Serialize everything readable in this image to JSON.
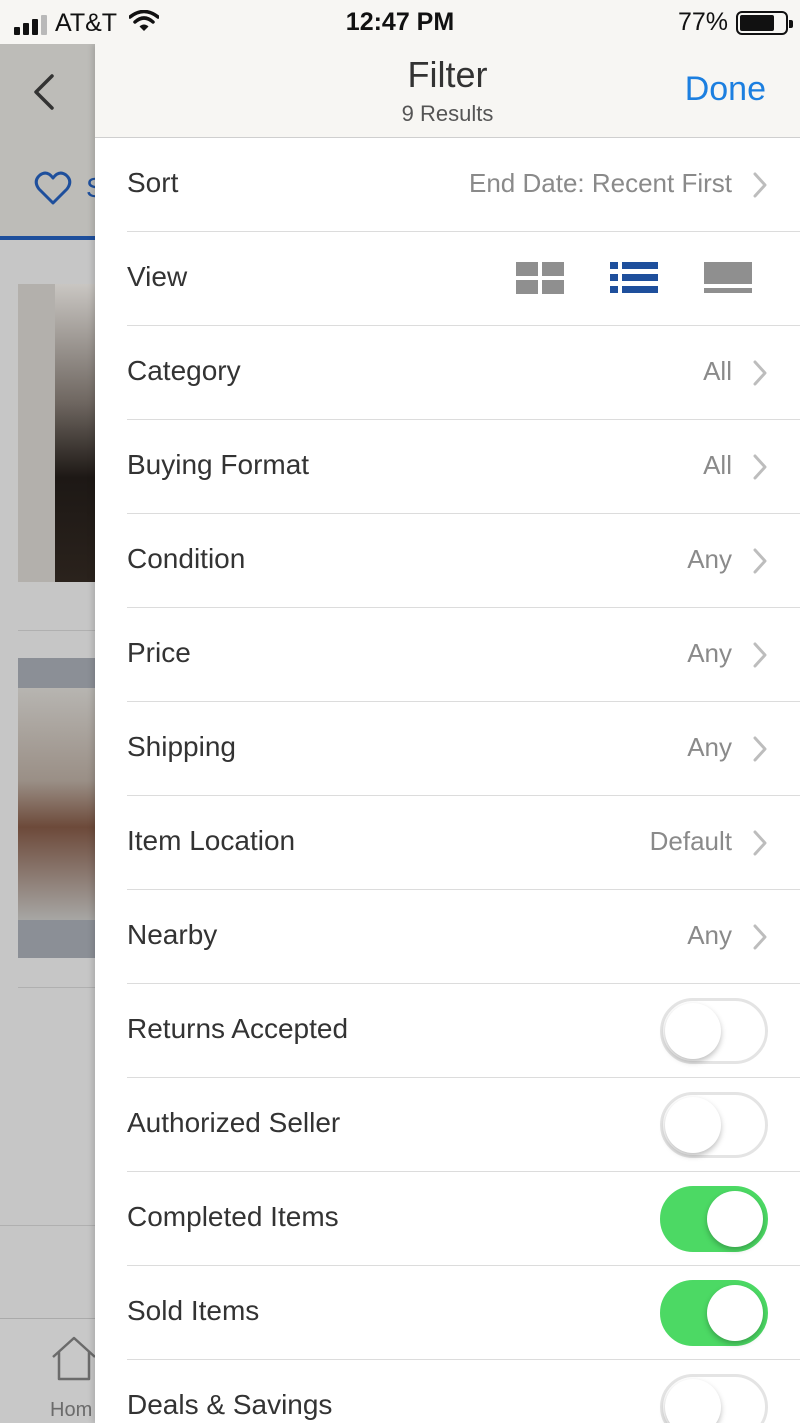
{
  "status_bar": {
    "carrier": "AT&T",
    "time": "12:47 PM",
    "battery_percent": "77%",
    "battery_level": 0.77
  },
  "background_page": {
    "tab_partial": "S",
    "home_label_partial": "Hom"
  },
  "filter": {
    "title": "Filter",
    "results": "9 Results",
    "done_label": "Done",
    "accent_color": "#1c7fe0",
    "toggle_on_color": "#4cd964",
    "rows": {
      "sort": {
        "label": "Sort",
        "value": "End Date: Recent First"
      },
      "view": {
        "label": "View",
        "selected": "list",
        "options": [
          "grid",
          "list",
          "gallery"
        ]
      },
      "category": {
        "label": "Category",
        "value": "All"
      },
      "buying_format": {
        "label": "Buying Format",
        "value": "All"
      },
      "condition": {
        "label": "Condition",
        "value": "Any"
      },
      "price": {
        "label": "Price",
        "value": "Any"
      },
      "shipping": {
        "label": "Shipping",
        "value": "Any"
      },
      "item_location": {
        "label": "Item Location",
        "value": "Default"
      },
      "nearby": {
        "label": "Nearby",
        "value": "Any"
      },
      "returns_accepted": {
        "label": "Returns Accepted",
        "on": false
      },
      "authorized_seller": {
        "label": "Authorized Seller",
        "on": false
      },
      "completed_items": {
        "label": "Completed Items",
        "on": true
      },
      "sold_items": {
        "label": "Sold Items",
        "on": true
      },
      "deals_savings": {
        "label": "Deals & Savings",
        "on": false
      }
    }
  }
}
